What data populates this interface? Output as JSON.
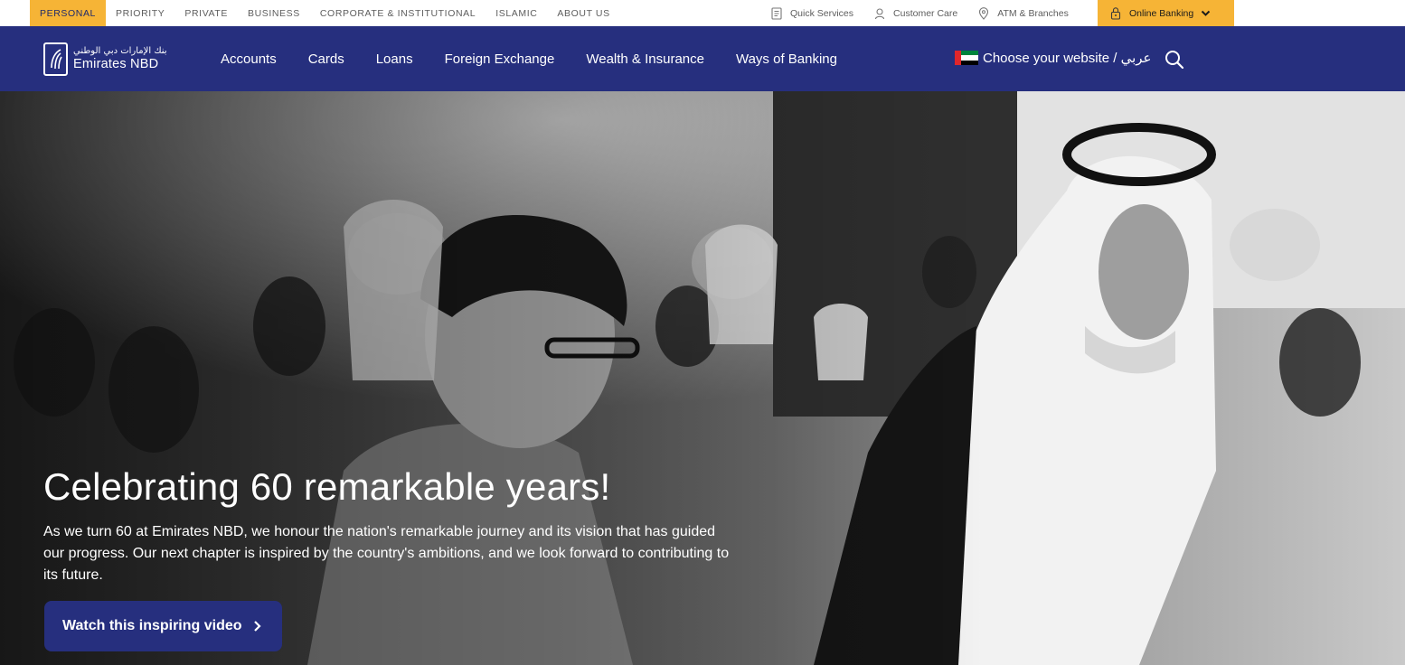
{
  "utility_bar": {
    "segments": [
      {
        "label": "PERSONAL",
        "active": true
      },
      {
        "label": "PRIORITY",
        "active": false
      },
      {
        "label": "PRIVATE",
        "active": false
      },
      {
        "label": "BUSINESS",
        "active": false
      },
      {
        "label": "CORPORATE & INSTITUTIONAL",
        "active": false
      },
      {
        "label": "ISLAMIC",
        "active": false
      },
      {
        "label": "ABOUT US",
        "active": false
      }
    ],
    "links": [
      {
        "label": "Quick Services",
        "icon": "receipt-icon"
      },
      {
        "label": "Customer Care",
        "icon": "headset-icon"
      },
      {
        "label": "ATM & Branches",
        "icon": "map-pin-icon"
      }
    ],
    "online_banking_label": "Online Banking"
  },
  "main_nav": {
    "logo": {
      "arabic": "بنك الإمارات دبي الوطني",
      "name": "Emirates NBD"
    },
    "items": [
      "Accounts",
      "Cards",
      "Loans",
      "Foreign Exchange",
      "Wealth & Insurance",
      "Ways of Banking"
    ],
    "choose_site_label": "Choose your website / عربي"
  },
  "hero": {
    "title": "Celebrating 60 remarkable years!",
    "body": "As we turn 60 at Emirates NBD, we honour the nation's remarkable journey and its vision that has guided our progress. Our next chapter is inspired by the country's ambitions, and we look forward to contributing to its future.",
    "cta_label": "Watch this inspiring video"
  },
  "colors": {
    "nav_blue": "#262f7e",
    "accent_gold": "#f6b436",
    "white": "#ffffff"
  }
}
